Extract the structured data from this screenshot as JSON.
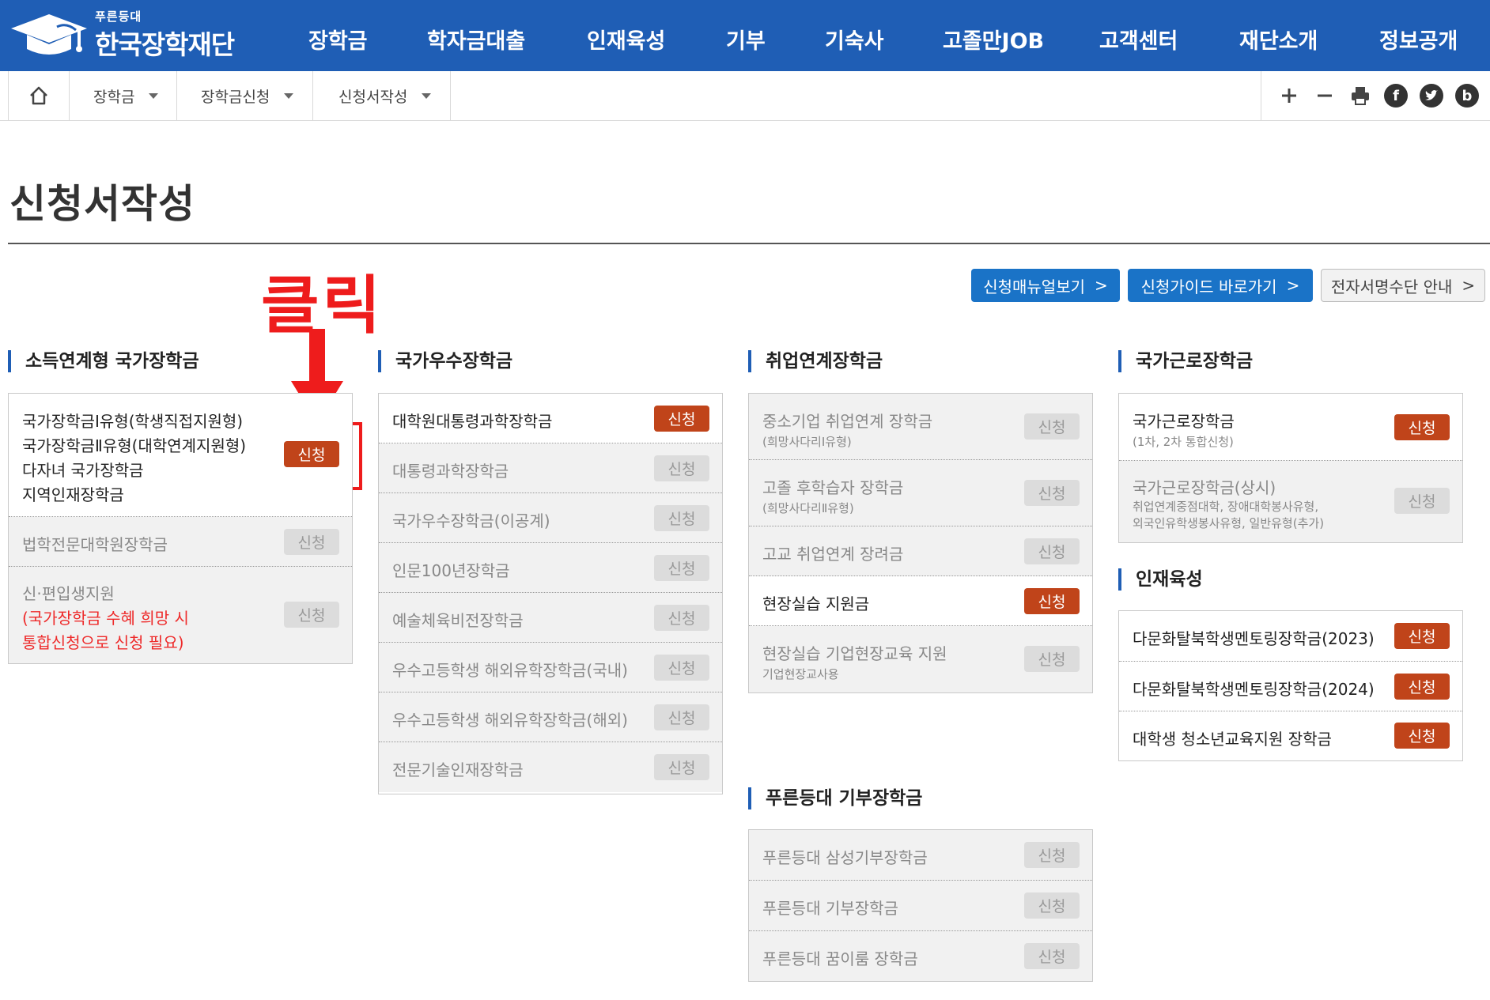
{
  "header": {
    "logo_small": "푸른등대",
    "logo_main": "한국장학재단",
    "menu": [
      "장학금",
      "학자금대출",
      "인재육성",
      "기부",
      "기숙사",
      "고졸만JOB",
      "고객센터",
      "재단소개",
      "정보공개"
    ]
  },
  "breadcrumb": {
    "home_icon": "home-icon",
    "items": [
      "장학금",
      "장학금신청",
      "신청서작성"
    ],
    "tools": [
      "zoom-in-icon",
      "zoom-out-icon",
      "print-icon",
      "facebook-icon",
      "twitter-icon",
      "blog-icon"
    ]
  },
  "page": {
    "title": "신청서작성"
  },
  "guides": [
    "신청매뉴얼보기",
    "신청가이드 바로가기",
    "전자서명수단 안내"
  ],
  "guide_chevron": ">",
  "annotation": {
    "text": "클릭",
    "color": "#ee1c1c"
  },
  "apply_label": "신청",
  "colors": {
    "nav_blue": "#1f5eb5",
    "apply_active": "#c0441a",
    "apply_inactive": "#dcdcdc"
  },
  "sections": {
    "income": {
      "title": "소득연계형 국가장학금",
      "row1_lines": [
        "국가장학금Ⅰ유형(학생직접지원형)",
        "국가장학금Ⅱ유형(대학연계지원형)",
        "다자녀 국가장학금",
        "지역인재장학금"
      ],
      "row2": "법학전문대학원장학금",
      "row3_title": "신·편입생지원",
      "row3_note": [
        "(국가장학금 수혜 희망 시",
        "통합신청으로 신청 필요)"
      ]
    },
    "excellence": {
      "title": "국가우수장학금",
      "items": [
        "대학원대통령과학장학금",
        "대통령과학장학금",
        "국가우수장학금(이공계)",
        "인문100년장학금",
        "예술체육비전장학금",
        "우수고등학생 해외유학장학금(국내)",
        "우수고등학생 해외유학장학금(해외)",
        "전문기술인재장학금"
      ]
    },
    "employment": {
      "title": "취업연계장학금",
      "items": [
        {
          "label": "중소기업 취업연계 장학금",
          "sub": "(희망사다리Ⅰ유형)"
        },
        {
          "label": "고졸 후학습자 장학금",
          "sub": "(희망사다리Ⅱ유형)"
        },
        {
          "label": "고교 취업연계 장려금",
          "sub": ""
        },
        {
          "label": "현장실습 지원금",
          "sub": ""
        },
        {
          "label": "현장실습 기업현장교육 지원",
          "sub": "기업현장교사용"
        }
      ]
    },
    "donation": {
      "title": "푸른등대 기부장학금",
      "items": [
        "푸른등대 삼성기부장학금",
        "푸른등대 기부장학금",
        "푸른등대 꿈이룸 장학금"
      ]
    },
    "work": {
      "title": "국가근로장학금",
      "item1_label": "국가근로장학금",
      "item1_sub": "(1차, 2차 통합신청)",
      "item2_label": "국가근로장학금(상시)",
      "item2_sub": [
        "취업연계중점대학, 장애대학봉사유형,",
        "외국인유학생봉사유형, 일반유형(추가)"
      ]
    },
    "talent": {
      "title": "인재육성",
      "items": [
        "다문화탈북학생멘토링장학금(2023)",
        "다문화탈북학생멘토링장학금(2024)",
        "대학생 청소년교육지원 장학금"
      ]
    }
  }
}
